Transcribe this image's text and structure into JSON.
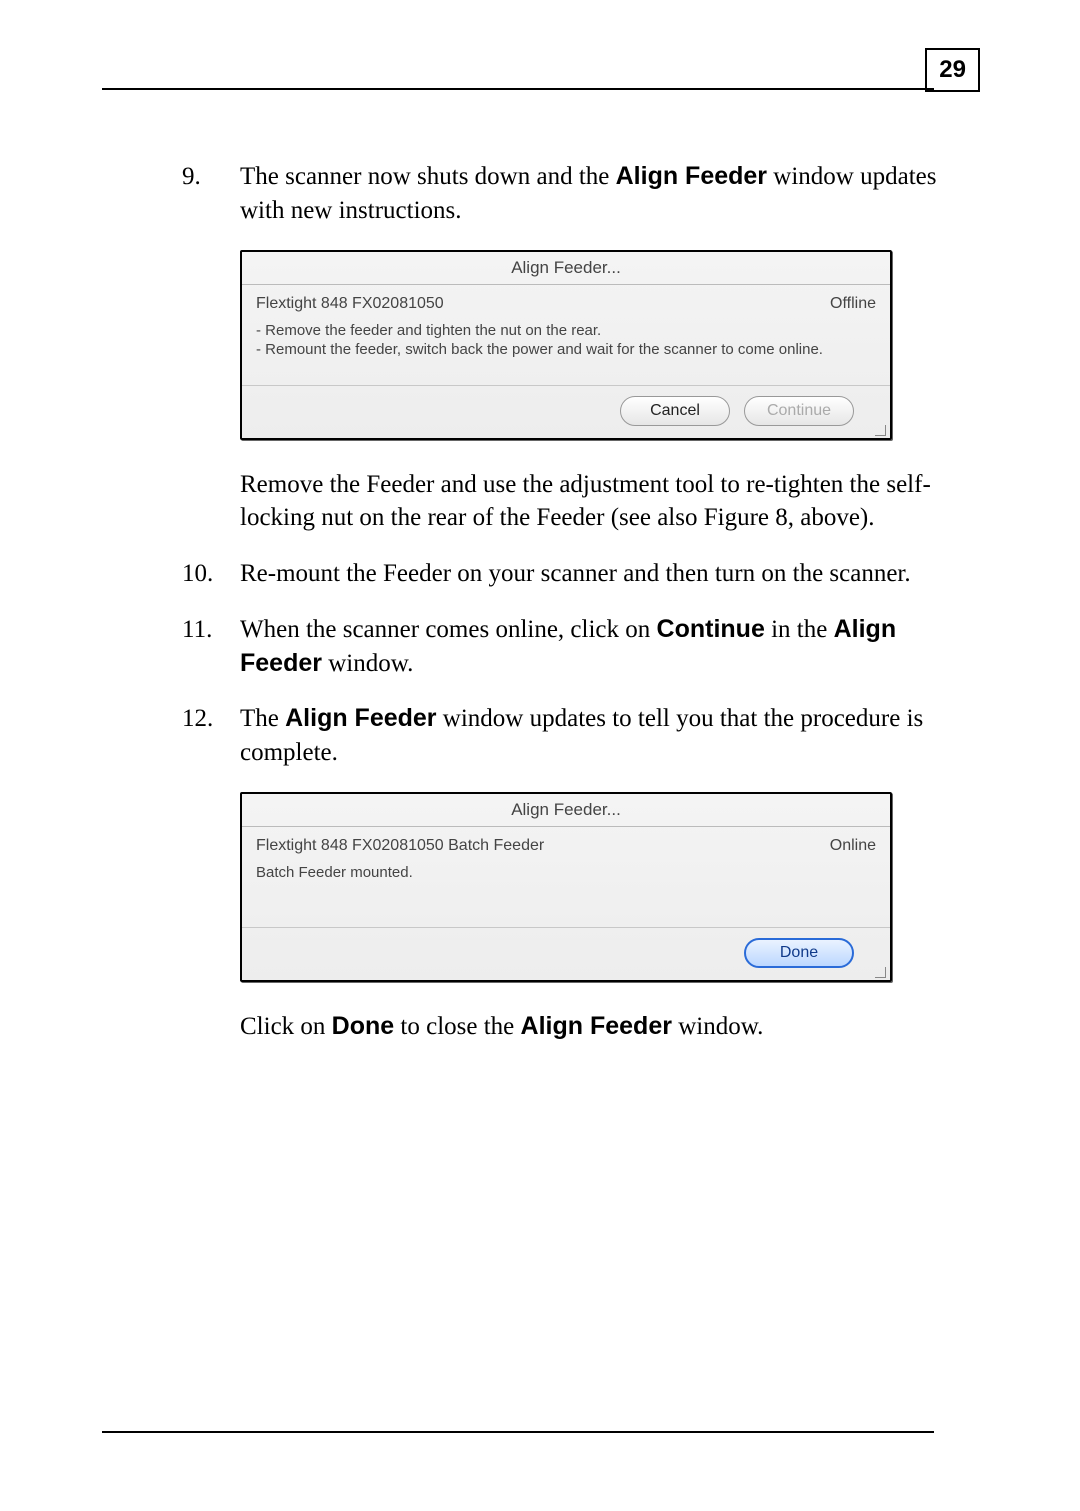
{
  "page_number": "29",
  "steps": {
    "s9": {
      "num": "9.",
      "text_prefix": "The scanner now shuts down and the ",
      "bold1": "Align Feeder",
      "text_suffix": " window updates with new instructions."
    },
    "dialog1": {
      "title": "Align Feeder...",
      "device": "Flextight 848 FX02081050",
      "status": "Offline",
      "line1": "- Remove the feeder and tighten the nut on the rear.",
      "line2": "- Remount the feeder, switch back the power and wait for the scanner to come online.",
      "cancel": "Cancel",
      "continue": "Continue"
    },
    "after9": "Remove the Feeder and use the adjustment tool to re-tighten the self-locking nut on the rear of the Feeder (see also Figure 8, above).",
    "s10": {
      "num": "10.",
      "text": "Re-mount the Feeder on your scanner and then turn on the scanner."
    },
    "s11": {
      "num": "11.",
      "t1": "When the scanner comes online, click on ",
      "b1": "Continue",
      "t2": " in the ",
      "b2": "Align Feeder",
      "t3": " window."
    },
    "s12": {
      "num": "12.",
      "t1": "The ",
      "b1": "Align Feeder",
      "t2": " window updates to tell you that the procedure is complete."
    },
    "dialog2": {
      "title": "Align Feeder...",
      "device": "Flextight 848 FX02081050 Batch Feeder",
      "status": "Online",
      "body": "Batch Feeder mounted.",
      "done": "Done"
    },
    "after12": {
      "t1": "Click on ",
      "b1": "Done",
      "t2": " to close the ",
      "b2": "Align Feeder",
      "t3": " window."
    }
  }
}
